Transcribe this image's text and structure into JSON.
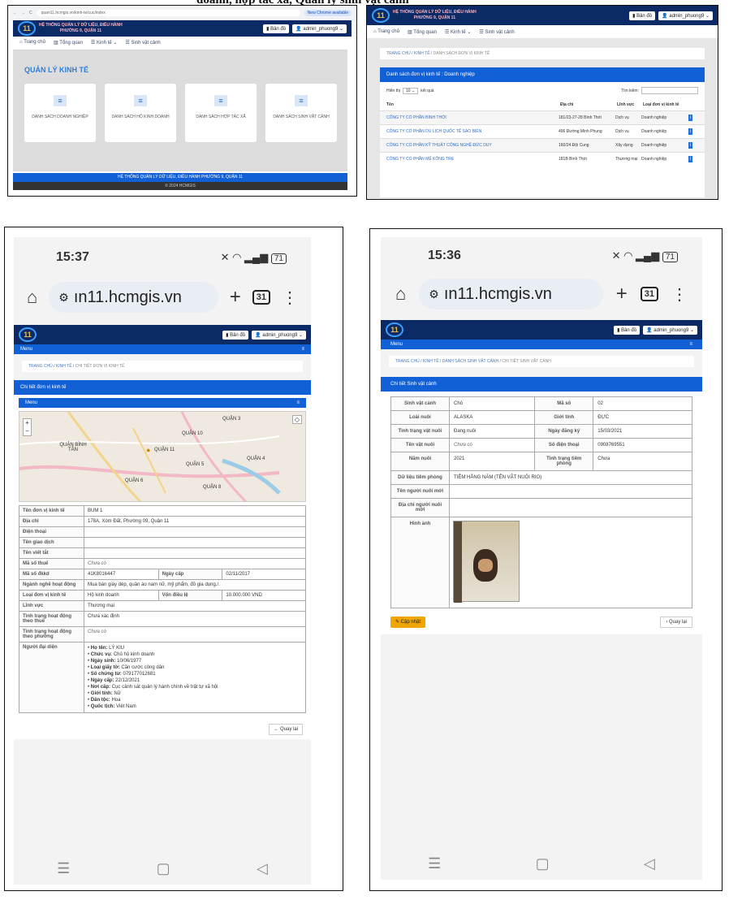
{
  "caption_tail": "doanh, hợp tác xã, Quản lý sinh vật cảnh",
  "p1": {
    "url": "quan11.hcmgis.vn/kinh-te/cuc/index",
    "chrome_badge": "New Chrome available",
    "brand_line1": "HỆ THỐNG QUẢN LÝ DỮ LIỆU, ĐIỀU HÀNH",
    "brand_line2": "PHƯỜNG 9, QUẬN 11",
    "map_btn": "Bản đồ",
    "user_btn": "admin_phuong9",
    "nav": [
      "Trang chủ",
      "Tổng quan",
      "Kinh tế",
      "Sinh vật cảnh"
    ],
    "heading": "QUẢN LÝ KINH TẾ",
    "cards": [
      "DANH SÁCH DOANH NGHIỆP",
      "DANH SÁCH HỘ KINH DOANH",
      "DANH SÁCH HỢP TÁC XÃ",
      "DANH SÁCH SINH VẬT CẢNH"
    ],
    "footer1": "HỆ THỐNG QUẢN LÝ DỮ LIỆU, ĐIỀU HÀNH PHƯỜNG 9, QUẬN 11",
    "footer2": "© 2024 HCMGIS"
  },
  "p2": {
    "brand_line1": "HỆ THỐNG QUẢN LÝ DỮ LIỆU, ĐIỀU HÀNH",
    "brand_line2": "PHƯỜNG 9, QUẬN 11",
    "map_btn": "Bản đồ",
    "user_btn": "admin_phuong9",
    "nav": [
      "Trang chủ",
      "Tổng quan",
      "Kinh tế",
      "Sinh vật cảnh"
    ],
    "crumb_a": "TRANG CHỦ",
    "crumb_b": "KINH TẾ",
    "crumb_c": "DANH SÁCH ĐƠN VỊ KINH TẾ",
    "title": "Danh sách đơn vị kinh tế : Doanh nghiệp",
    "show_pre": "Hiển thị",
    "show_val": "10",
    "show_post": "kết quả",
    "search_label": "Tìm kiếm:",
    "headers": [
      "Tên",
      "Địa chỉ",
      "Lĩnh vực",
      "Loại đơn vị kinh tế"
    ],
    "rows": [
      [
        "CÔNG TY CỔ PHẦN BÌNH THỚI",
        "181/23-27-28 Bình Thới",
        "Dịch vụ",
        "Doanh nghiệp"
      ],
      [
        "CÔNG TY CỔ PHẦN DU LỊCH QUỐC TẾ SAO BIỂN",
        "496 Đường Minh Phụng",
        "Dịch vụ",
        "Doanh nghiệp"
      ],
      [
        "CÔNG TY CỔ PHẦN KỸ THUẬT CÔNG NGHỆ ĐỨC DUY",
        "160/24 Đội Cung",
        "Xây dựng",
        "Doanh nghiệp"
      ],
      [
        "CÔNG TY CỔ PHẦN MÊ KÔNG TRE",
        "181B Bình Thới",
        "Thương mại",
        "Doanh nghiệp"
      ]
    ]
  },
  "p3": {
    "time": "15:37",
    "battery": "71",
    "url": "ın11.hcmgis.vn",
    "tabs": "31",
    "map_btn": "Bản đồ",
    "user_btn": "admin_phuong9",
    "menu": "Menu",
    "crumb_a": "TRANG CHỦ",
    "crumb_b": "KINH TẾ",
    "crumb_c": "CHI TIẾT ĐƠN VỊ KINH TẾ",
    "title": "Chi tiết đơn vị kinh tế",
    "menu2": "Menu",
    "map_labels": [
      "QUẬN 3",
      "QUẬN 10",
      "QUẬN BÌNH TÂN",
      "QUẬN 11",
      "QUẬN 5",
      "QUẬN 4",
      "QUẬN 6",
      "QUẬN 8"
    ],
    "details": [
      [
        "Tên đơn vị kinh tế",
        "BUM 1"
      ],
      [
        "Địa chỉ",
        "178A, Xóm Đất, Phường 09, Quận 11"
      ],
      [
        "Điện thoại",
        ""
      ],
      [
        "Tên giao dịch",
        ""
      ],
      [
        "Tên viết tắt",
        ""
      ],
      [
        "Mã số thuế",
        "Chưa có"
      ]
    ],
    "dkkd_label": "Mã số đkkd",
    "dkkd_val": "41K8016447",
    "date_label": "Ngày cấp",
    "date_val": "02/11/2017",
    "nganh_label": "Ngành nghề hoạt động",
    "nganh_val": "Mua bán giày dép, quần áo nam nữ, mỹ phẩm, đồ gia dụng./.",
    "loai_label": "Loại đơn vị kinh tế",
    "loai_val": "Hộ kinh doanh",
    "von_label": "Vốn điều lệ",
    "von_val": "10.000.000 VND",
    "more": [
      [
        "Lĩnh vực",
        "Thương mại"
      ],
      [
        "Tình trạng hoạt động theo thuế",
        "Chưa xác định"
      ],
      [
        "Tình trạng hoạt động theo phường",
        "Chưa có"
      ]
    ],
    "rep_label": "Người đại diện",
    "rep": [
      [
        "Họ tên:",
        "LÝ KIU"
      ],
      [
        "Chức vụ:",
        "Chủ hộ kinh doanh"
      ],
      [
        "Ngày sinh:",
        "10/06/1977"
      ],
      [
        "Loại giấy tờ:",
        "Căn cước công dân"
      ],
      [
        "Số chứng từ:",
        "079177012681"
      ],
      [
        "Ngày cấp:",
        "22/12/2021"
      ],
      [
        "Nơi cấp:",
        "Cục cảnh sát quản lý hành chính về trật tự xã hội"
      ],
      [
        "Giới tính:",
        "Nữ"
      ],
      [
        "Dân tộc:",
        "Hoa"
      ],
      [
        "Quốc tịch:",
        "Việt Nam"
      ]
    ],
    "back": "Quay lại"
  },
  "p4": {
    "time": "15:36",
    "battery": "71",
    "url": "ın11.hcmgis.vn",
    "tabs": "31",
    "map_btn": "Bản đồ",
    "user_btn": "admin_phuong9",
    "menu": "Menu",
    "crumb_a": "TRANG CHỦ",
    "crumb_b": "KINH TẾ",
    "crumb_c": "DANH SÁCH SINH VẬT CẢNH",
    "crumb_d": "CHI TIẾT SINH VẬT CẢNH",
    "title": "Chi tiết Sinh vật cảnh",
    "grid": [
      [
        "Sinh vật cảnh",
        "Chó",
        "Mã số",
        "02"
      ],
      [
        "Loài nuôi",
        "ALASKA",
        "Giới tính",
        "ĐỰC"
      ],
      [
        "Tình trạng vật nuôi",
        "Đang nuôi",
        "Ngày đăng ký",
        "15/03/2021"
      ],
      [
        "Tên vật nuôi",
        "Chưa có",
        "Số điện thoại",
        "0908769551"
      ],
      [
        "Năm nuôi",
        "2021",
        "Tình trạng tiêm phòng",
        "Chưa"
      ]
    ],
    "full": [
      [
        "Dữ liệu tiêm phòng",
        "TIÊM HẰNG NĂM (TÊN VẬT NUÔI RIO)"
      ],
      [
        "Tên người nuôi mới",
        ""
      ],
      [
        "Địa chỉ người nuôi mới",
        ""
      ]
    ],
    "img_label": "Hình ảnh",
    "update": "Cập nhật",
    "back": "Quay lại"
  }
}
